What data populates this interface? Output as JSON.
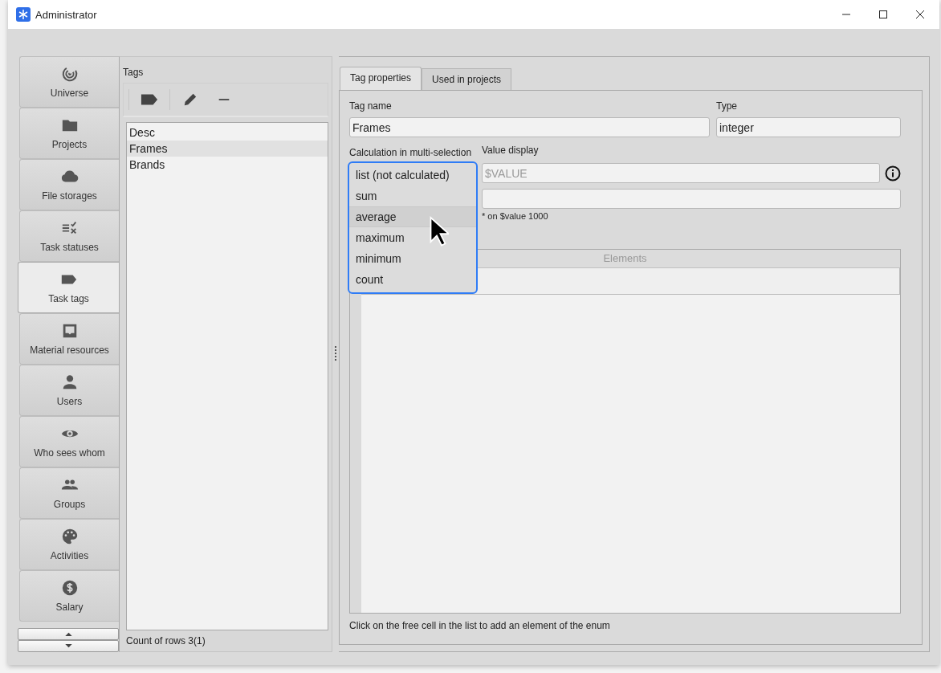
{
  "window": {
    "title": "Administrator"
  },
  "nav": {
    "items": [
      {
        "label": "Universe",
        "kind": "spiral",
        "selected": false
      },
      {
        "label": "Projects",
        "kind": "folder",
        "selected": false
      },
      {
        "label": "File storages",
        "kind": "cloud",
        "selected": false
      },
      {
        "label": "Task statuses",
        "kind": "checklist",
        "selected": false
      },
      {
        "label": "Task tags",
        "kind": "tag",
        "selected": true
      },
      {
        "label": "Material resources",
        "kind": "inbox",
        "selected": false
      },
      {
        "label": "Users",
        "kind": "person",
        "selected": false
      },
      {
        "label": "Who sees whom",
        "kind": "eye",
        "selected": false
      },
      {
        "label": "Groups",
        "kind": "group",
        "selected": false
      },
      {
        "label": "Activities",
        "kind": "palette",
        "selected": false
      },
      {
        "label": "Salary",
        "kind": "dollar",
        "selected": false
      }
    ]
  },
  "tags": {
    "title": "Tags",
    "rows": [
      {
        "label": "Desc",
        "selected": false
      },
      {
        "label": "Frames",
        "selected": true
      },
      {
        "label": "Brands",
        "selected": false
      }
    ],
    "footer": "Count of rows 3(1)"
  },
  "tabs": [
    {
      "label": "Tag properties",
      "selected": true
    },
    {
      "label": "Used in projects",
      "selected": false
    }
  ],
  "form": {
    "tag_name": {
      "label": "Tag name",
      "value": "Frames"
    },
    "type": {
      "label": "Type",
      "value": "integer"
    },
    "calculation": {
      "label": "Calculation in multi-selection",
      "options": [
        {
          "label": "list (not calculated)",
          "highlighted": false
        },
        {
          "label": "sum",
          "highlighted": false
        },
        {
          "label": "average",
          "highlighted": true
        },
        {
          "label": "maximum",
          "highlighted": false
        },
        {
          "label": "minimum",
          "highlighted": false
        },
        {
          "label": "count",
          "highlighted": false
        }
      ]
    },
    "value_display": {
      "label": "Value display",
      "placeholder": "$VALUE",
      "note": "* on $value 1000"
    },
    "elements": {
      "header": "Elements"
    },
    "hint": "Click on the free cell in the list to add an element of the enum"
  }
}
